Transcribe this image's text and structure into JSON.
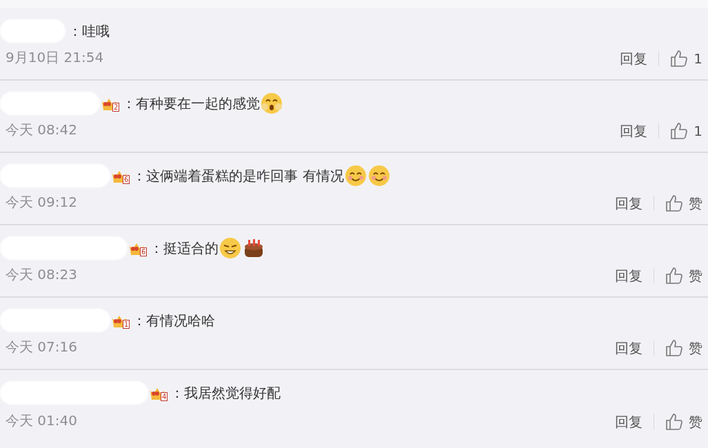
{
  "comments": [
    {
      "text": "：哇哦",
      "time": "9月10日 21:54",
      "reply": "回复",
      "likes": "1"
    },
    {
      "badge_level": "2",
      "text": "：有种要在一起的感觉",
      "emojis": [
        {
          "kind": "blush"
        }
      ],
      "time": "今天 08:42",
      "reply": "回复",
      "likes": "1"
    },
    {
      "badge_level": "6",
      "text": "：这俩端着蛋糕的是咋回事 有情况",
      "emojis": [
        {
          "kind": "smile"
        },
        {
          "kind": "smile"
        }
      ],
      "time": "今天 09:12",
      "reply": "回复",
      "likes": "赞"
    },
    {
      "badge_level": "6",
      "text": "：挺适合的",
      "emojis": [
        {
          "kind": "squint"
        },
        {
          "kind": "cake"
        }
      ],
      "time": "今天 08:23",
      "reply": "回复",
      "likes": "赞"
    },
    {
      "badge_level": "1",
      "text": "：有情况哈哈",
      "time": "今天 07:16",
      "reply": "回复",
      "likes": "赞"
    },
    {
      "badge_level": "4",
      "text": "：我居然觉得好配",
      "time": "今天 01:40",
      "reply": "回复",
      "likes": "赞"
    }
  ]
}
